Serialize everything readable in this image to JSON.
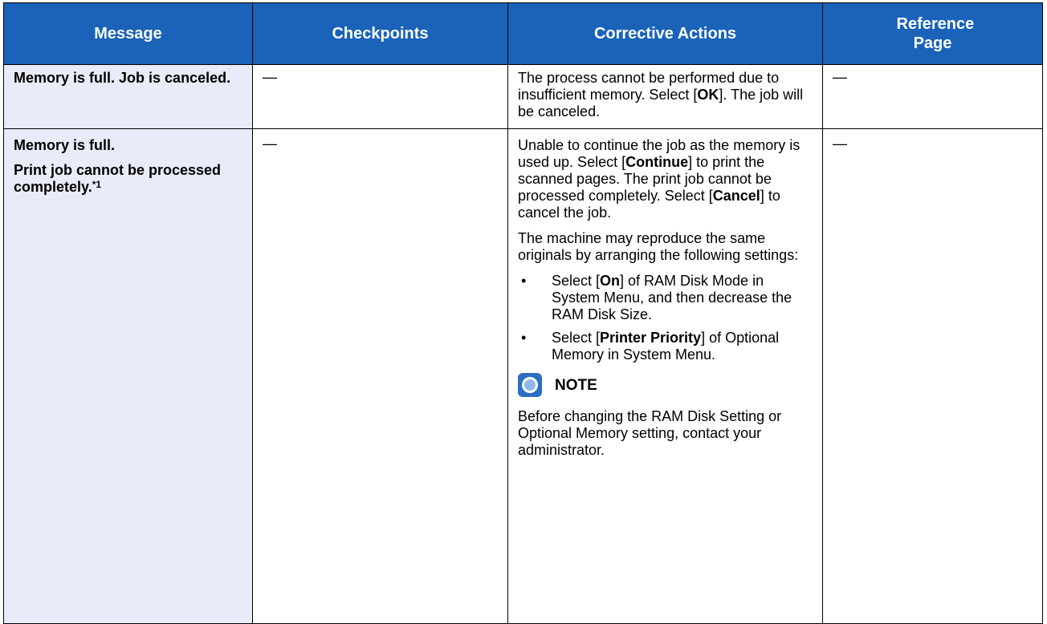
{
  "headers": {
    "message": "Message",
    "checkpoints": "Checkpoints",
    "corrective": "Corrective Actions",
    "reference": "Reference Page"
  },
  "rows": [
    {
      "message_line1": "Memory is full. Job is canceled.",
      "checkpoints": "—",
      "corrective_pre": "The process cannot be performed due to insufficient memory. Select [",
      "corrective_kw": "OK",
      "corrective_post": "]. The job will be canceled.",
      "reference": "—"
    },
    {
      "message_line1": "Memory is full.",
      "message_line2": "Print job cannot be processed completely.",
      "message_sup": "*1",
      "checkpoints": "—",
      "para1": {
        "t1": "Unable to continue the job as the memory is used up. Select [",
        "k1": "Continue",
        "t2": "] to print the scanned pages. The print job cannot be processed completely. Select [",
        "k2": "Cancel",
        "t3": "] to cancel the job."
      },
      "para2": "The machine may reproduce the same originals by arranging the following settings:",
      "bullet_symbol": "•",
      "bullet1": {
        "t1": "Select [",
        "k1": "On",
        "t2": "] of RAM Disk Mode in System Menu, and then decrease the RAM Disk Size."
      },
      "bullet2": {
        "t1": "Select [",
        "k1": "Printer Priority",
        "t2": "] of Optional Memory in System Menu."
      },
      "note_title": "NOTE",
      "note_text": "Before changing the RAM Disk Setting or Optional Memory setting, contact your administrator.",
      "reference": "—"
    }
  ]
}
